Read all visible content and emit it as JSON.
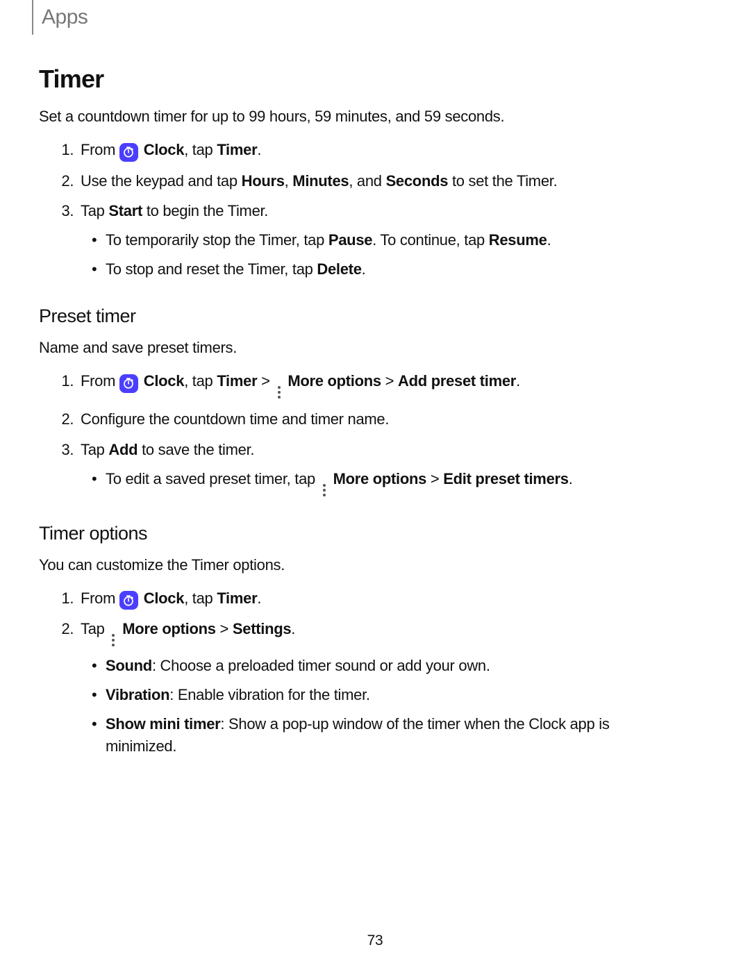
{
  "header": {
    "breadcrumb": "Apps"
  },
  "page_number": "73",
  "section1": {
    "title": "Timer",
    "intro": "Set a countdown timer for up to 99 hours, 59 minutes, and 59 seconds.",
    "step1_pre": "From ",
    "step1_clock": "Clock",
    "step1_mid": ", tap ",
    "step1_timer": "Timer",
    "step1_end": ".",
    "step2_a": "Use the keypad and tap ",
    "step2_hours": "Hours",
    "step2_b": ", ",
    "step2_minutes": "Minutes",
    "step2_c": ", and ",
    "step2_seconds": "Seconds",
    "step2_d": " to set the Timer.",
    "step3_a": "Tap ",
    "step3_start": "Start",
    "step3_b": " to begin the Timer.",
    "b1_a": "To temporarily stop the Timer, tap ",
    "b1_pause": "Pause",
    "b1_b": ". To continue, tap ",
    "b1_resume": "Resume",
    "b1_c": ".",
    "b2_a": "To stop and reset the Timer, tap ",
    "b2_delete": "Delete",
    "b2_b": "."
  },
  "section2": {
    "title": "Preset timer",
    "intro": "Name and save preset timers.",
    "step1_pre": "From ",
    "step1_clock": "Clock",
    "step1_mid": ", tap ",
    "step1_timer": "Timer",
    "step1_gt1": " > ",
    "step1_more": "More options",
    "step1_gt2": " > ",
    "step1_add": "Add preset timer",
    "step1_end": ".",
    "step2": "Configure the countdown time and timer name.",
    "step3_a": "Tap ",
    "step3_add": "Add",
    "step3_b": " to save the timer.",
    "b1_a": "To edit a saved preset timer, tap ",
    "b1_more": "More options",
    "b1_gt": " > ",
    "b1_edit": "Edit preset timers",
    "b1_b": "."
  },
  "section3": {
    "title": "Timer options",
    "intro": "You can customize the Timer options.",
    "step1_pre": "From ",
    "step1_clock": "Clock",
    "step1_mid": ", tap ",
    "step1_timer": "Timer",
    "step1_end": ".",
    "step2_a": "Tap ",
    "step2_more": "More options",
    "step2_gt": " > ",
    "step2_settings": "Settings",
    "step2_b": ".",
    "b1_k": "Sound",
    "b1_v": ": Choose a preloaded timer sound or add your own.",
    "b2_k": "Vibration",
    "b2_v": ": Enable vibration for the timer.",
    "b3_k": "Show mini timer",
    "b3_v": ": Show a pop-up window of the timer when the Clock app is minimized."
  }
}
